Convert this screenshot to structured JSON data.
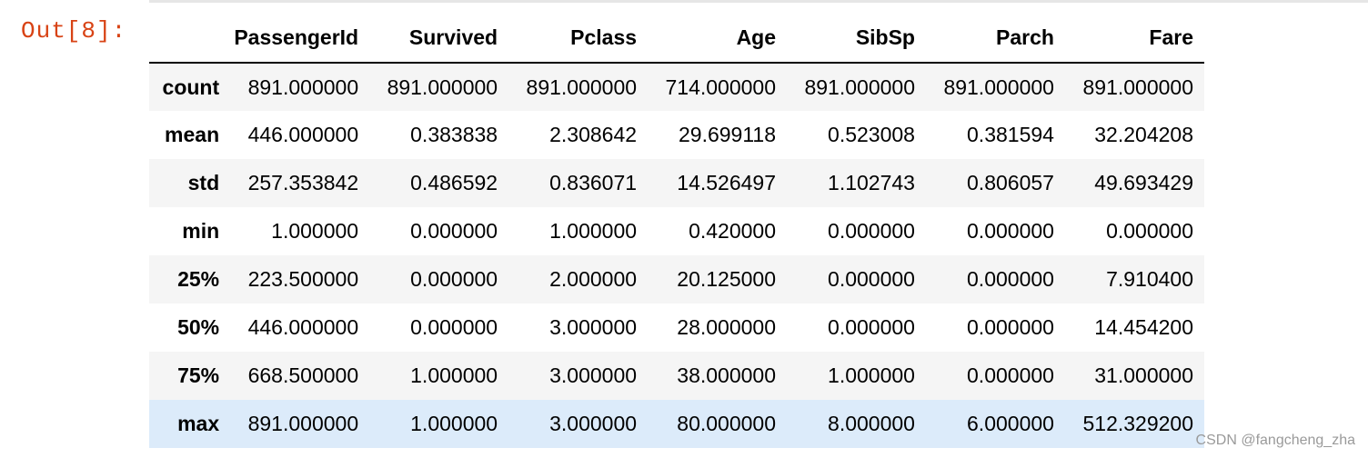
{
  "cell": {
    "out_prompt": "Out[8]:"
  },
  "table": {
    "columns": [
      "",
      "PassengerId",
      "Survived",
      "Pclass",
      "Age",
      "SibSp",
      "Parch",
      "Fare"
    ],
    "rows": [
      {
        "label": "count",
        "values": [
          "891.000000",
          "891.000000",
          "891.000000",
          "714.000000",
          "891.000000",
          "891.000000",
          "891.000000"
        ]
      },
      {
        "label": "mean",
        "values": [
          "446.000000",
          "0.383838",
          "2.308642",
          "29.699118",
          "0.523008",
          "0.381594",
          "32.204208"
        ]
      },
      {
        "label": "std",
        "values": [
          "257.353842",
          "0.486592",
          "0.836071",
          "14.526497",
          "1.102743",
          "0.806057",
          "49.693429"
        ]
      },
      {
        "label": "min",
        "values": [
          "1.000000",
          "0.000000",
          "1.000000",
          "0.420000",
          "0.000000",
          "0.000000",
          "0.000000"
        ]
      },
      {
        "label": "25%",
        "values": [
          "223.500000",
          "0.000000",
          "2.000000",
          "20.125000",
          "0.000000",
          "0.000000",
          "7.910400"
        ]
      },
      {
        "label": "50%",
        "values": [
          "446.000000",
          "0.000000",
          "3.000000",
          "28.000000",
          "0.000000",
          "0.000000",
          "14.454200"
        ]
      },
      {
        "label": "75%",
        "values": [
          "668.500000",
          "1.000000",
          "3.000000",
          "38.000000",
          "1.000000",
          "0.000000",
          "31.000000"
        ]
      },
      {
        "label": "max",
        "values": [
          "891.000000",
          "1.000000",
          "3.000000",
          "80.000000",
          "8.000000",
          "6.000000",
          "512.329200"
        ]
      }
    ],
    "highlighted_row": "max"
  },
  "watermark": "CSDN @fangcheng_zha",
  "colors": {
    "prompt": "#d84315",
    "stripe": "#f5f5f5",
    "hover": "#dcebfa"
  }
}
